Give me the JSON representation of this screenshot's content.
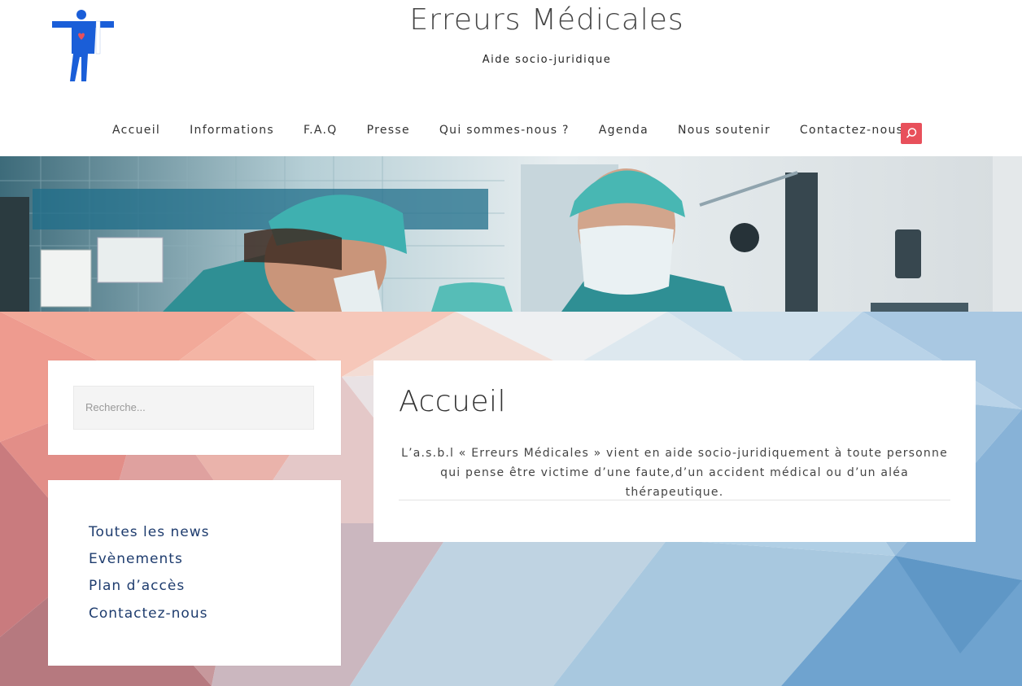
{
  "site": {
    "title": "Erreurs Médicales",
    "tagline": "Aide socio-juridique"
  },
  "nav": {
    "items": [
      "Accueil",
      "Informations",
      "F.A.Q",
      "Presse",
      "Qui sommes-nous ?",
      "Agenda",
      "Nous soutenir",
      "Contactez-nous"
    ],
    "search_icon": "search-icon"
  },
  "sidebar": {
    "search_placeholder": "Recherche...",
    "links": [
      "Toutes les news",
      "Evènements",
      "Plan d’accès",
      "Contactez-nous"
    ]
  },
  "main": {
    "title": "Accueil",
    "text": "L’a.s.b.l « Erreurs Médicales » vient en aide socio-juridiquement à toute personne qui pense être victime d’une faute,d’un accident médical ou d’un aléa thérapeutique."
  },
  "colors": {
    "accent": "#e8505b",
    "link": "#1e3c6e",
    "logo_blue": "#1a5ed8"
  }
}
